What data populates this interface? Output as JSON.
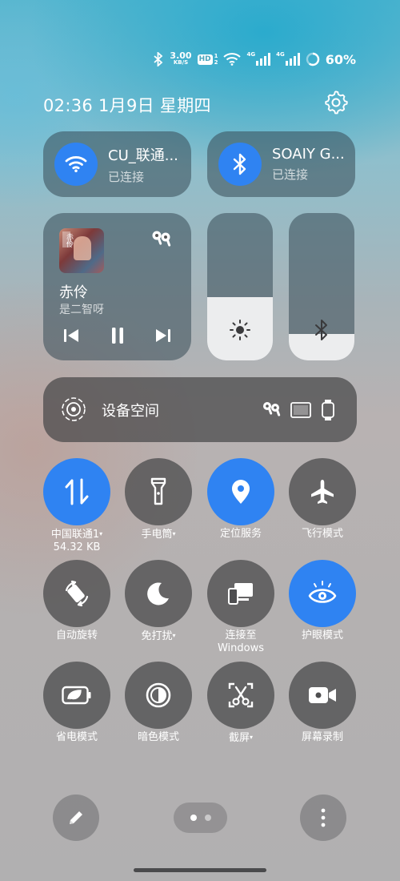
{
  "status_bar": {
    "speed_value": "3.00",
    "speed_unit": "KB/S",
    "hd_label": "HD",
    "hd_sub": "1\n2",
    "signal_tag": "4G",
    "signal_tag_2": "4G",
    "battery": "60%",
    "battery_level": 0.6
  },
  "header": {
    "datetime": "02:36  1月9日 星期四"
  },
  "wifi": {
    "name": "CU_联通...",
    "status": "已连接"
  },
  "bluetooth": {
    "name": "SOAIY G...",
    "status": "已连接"
  },
  "media": {
    "title": "赤伶",
    "artist": "是二智呀",
    "album_text": "赤伶"
  },
  "sliders": {
    "brightness_level": 0.43,
    "volume_level": 0.18
  },
  "device_space": {
    "label": "设备空间"
  },
  "toggles": [
    {
      "label": "中国联通1",
      "sublabel": "54.32 KB",
      "caret": "▾"
    },
    {
      "label": "手电筒",
      "caret": "▾"
    },
    {
      "label": "定位服务"
    },
    {
      "label": "飞行模式"
    },
    {
      "label": "自动旋转"
    },
    {
      "label": "免打扰",
      "caret": "▾"
    },
    {
      "label": "连接至",
      "sublabel": "Windows"
    },
    {
      "label": "护眼模式"
    },
    {
      "label": "省电模式"
    },
    {
      "label": "暗色模式"
    },
    {
      "label": "截屏",
      "caret": "▾"
    },
    {
      "label": "屏幕录制"
    }
  ],
  "colors": {
    "accent": "#2f83f2",
    "tile_dark": "#4e4e50"
  }
}
